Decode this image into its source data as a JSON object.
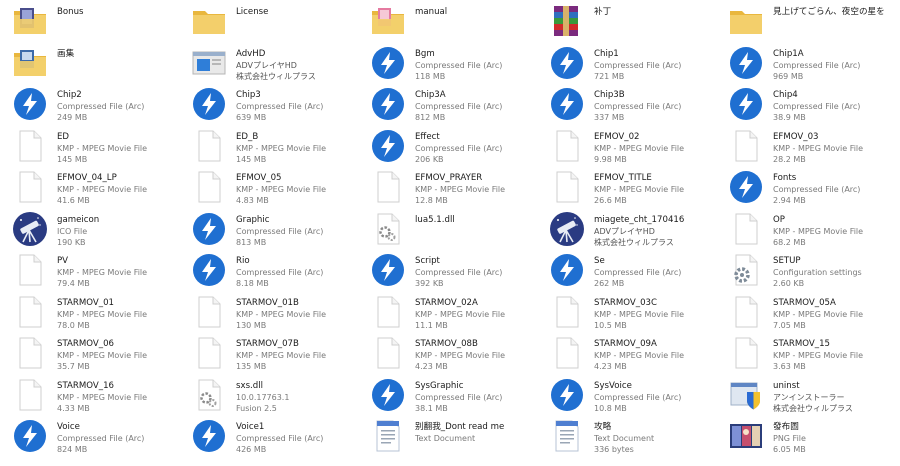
{
  "colors": {
    "folder_body": "#f3cf6b",
    "folder_tab": "#e9b73e",
    "arc_blue": "#1f6fd1",
    "doc_border": "#cfcfcf",
    "text_primary": "#1a1a1a",
    "text_secondary": "#7a7a7a"
  },
  "items": [
    {
      "name": "Bonus",
      "line2": "",
      "line3": "",
      "icon": "folder-icon-bonus"
    },
    {
      "name": "License",
      "line2": "",
      "line3": "",
      "icon": "folder-icon"
    },
    {
      "name": "manual",
      "line2": "",
      "line3": "",
      "icon": "folder-icon-manual"
    },
    {
      "name": "补丁",
      "line2": "",
      "line3": "",
      "icon": "winrar-icon"
    },
    {
      "name": "見上げてごらん、夜空の星を",
      "line2": "",
      "line3": "",
      "icon": "folder-icon"
    },
    {
      "name": "画集",
      "line2": "",
      "line3": "",
      "icon": "folder-icon-images"
    },
    {
      "name": "AdvHD",
      "line2": "ADVプレイヤHD",
      "line3": "株式会社ウィルプラス",
      "icon": "advhd-app-icon"
    },
    {
      "name": "Bgm",
      "line2": "Compressed File (Arc)",
      "line3": "118 MB",
      "icon": "arc-file-icon"
    },
    {
      "name": "Chip1",
      "line2": "Compressed File (Arc)",
      "line3": "721 MB",
      "icon": "arc-file-icon"
    },
    {
      "name": "Chip1A",
      "line2": "Compressed File (Arc)",
      "line3": "969 MB",
      "icon": "arc-file-icon"
    },
    {
      "name": "Chip2",
      "line2": "Compressed File (Arc)",
      "line3": "249 MB",
      "icon": "arc-file-icon"
    },
    {
      "name": "Chip3",
      "line2": "Compressed File (Arc)",
      "line3": "639 MB",
      "icon": "arc-file-icon"
    },
    {
      "name": "Chip3A",
      "line2": "Compressed File (Arc)",
      "line3": "812 MB",
      "icon": "arc-file-icon"
    },
    {
      "name": "Chip3B",
      "line2": "Compressed File (Arc)",
      "line3": "337 MB",
      "icon": "arc-file-icon"
    },
    {
      "name": "Chip4",
      "line2": "Compressed File (Arc)",
      "line3": "38.9 MB",
      "icon": "arc-file-icon"
    },
    {
      "name": "ED",
      "line2": "KMP - MPEG Movie File",
      "line3": "145 MB",
      "icon": "blank-file-icon"
    },
    {
      "name": "ED_B",
      "line2": "KMP - MPEG Movie File",
      "line3": "145 MB",
      "icon": "blank-file-icon"
    },
    {
      "name": "Effect",
      "line2": "Compressed File (Arc)",
      "line3": "206 KB",
      "icon": "arc-file-icon"
    },
    {
      "name": "EFMOV_02",
      "line2": "KMP - MPEG Movie File",
      "line3": "9.98 MB",
      "icon": "blank-file-icon"
    },
    {
      "name": "EFMOV_03",
      "line2": "KMP - MPEG Movie File",
      "line3": "28.2 MB",
      "icon": "blank-file-icon"
    },
    {
      "name": "EFMOV_04_LP",
      "line2": "KMP - MPEG Movie File",
      "line3": "41.6 MB",
      "icon": "blank-file-icon"
    },
    {
      "name": "EFMOV_05",
      "line2": "KMP - MPEG Movie File",
      "line3": "4.83 MB",
      "icon": "blank-file-icon"
    },
    {
      "name": "EFMOV_PRAYER",
      "line2": "KMP - MPEG Movie File",
      "line3": "12.8 MB",
      "icon": "blank-file-icon"
    },
    {
      "name": "EFMOV_TITLE",
      "line2": "KMP - MPEG Movie File",
      "line3": "26.6 MB",
      "icon": "blank-file-icon"
    },
    {
      "name": "Fonts",
      "line2": "Compressed File (Arc)",
      "line3": "2.94 MB",
      "icon": "arc-file-icon"
    },
    {
      "name": "gameicon",
      "line2": "ICO File",
      "line3": "190 KB",
      "icon": "telescope-icon"
    },
    {
      "name": "Graphic",
      "line2": "Compressed File (Arc)",
      "line3": "813 MB",
      "icon": "arc-file-icon"
    },
    {
      "name": "lua5.1.dll",
      "line2": "",
      "line3": "",
      "icon": "dll-file-icon"
    },
    {
      "name": "miagete_cht_170416",
      "line2": "ADVプレイヤHD",
      "line3": "株式会社ウィルプラス",
      "icon": "telescope-icon"
    },
    {
      "name": "OP",
      "line2": "KMP - MPEG Movie File",
      "line3": "68.2 MB",
      "icon": "blank-file-icon"
    },
    {
      "name": "PV",
      "line2": "KMP - MPEG Movie File",
      "line3": "79.4 MB",
      "icon": "blank-file-icon"
    },
    {
      "name": "Rio",
      "line2": "Compressed File (Arc)",
      "line3": "8.18 MB",
      "icon": "arc-file-icon"
    },
    {
      "name": "Script",
      "line2": "Compressed File (Arc)",
      "line3": "392 KB",
      "icon": "arc-file-icon"
    },
    {
      "name": "Se",
      "line2": "Compressed File (Arc)",
      "line3": "262 MB",
      "icon": "arc-file-icon"
    },
    {
      "name": "SETUP",
      "line2": "Configuration settings",
      "line3": "2.60 KB",
      "icon": "settings-file-icon"
    },
    {
      "name": "STARMOV_01",
      "line2": "KMP - MPEG Movie File",
      "line3": "78.0 MB",
      "icon": "blank-file-icon"
    },
    {
      "name": "STARMOV_01B",
      "line2": "KMP - MPEG Movie File",
      "line3": "130 MB",
      "icon": "blank-file-icon"
    },
    {
      "name": "STARMOV_02A",
      "line2": "KMP - MPEG Movie File",
      "line3": "11.1 MB",
      "icon": "blank-file-icon"
    },
    {
      "name": "STARMOV_03C",
      "line2": "KMP - MPEG Movie File",
      "line3": "10.5 MB",
      "icon": "blank-file-icon"
    },
    {
      "name": "STARMOV_05A",
      "line2": "KMP - MPEG Movie File",
      "line3": "7.05 MB",
      "icon": "blank-file-icon"
    },
    {
      "name": "STARMOV_06",
      "line2": "KMP - MPEG Movie File",
      "line3": "35.7 MB",
      "icon": "blank-file-icon"
    },
    {
      "name": "STARMOV_07B",
      "line2": "KMP - MPEG Movie File",
      "line3": "135 MB",
      "icon": "blank-file-icon"
    },
    {
      "name": "STARMOV_08B",
      "line2": "KMP - MPEG Movie File",
      "line3": "4.23 MB",
      "icon": "blank-file-icon"
    },
    {
      "name": "STARMOV_09A",
      "line2": "KMP - MPEG Movie File",
      "line3": "4.23 MB",
      "icon": "blank-file-icon"
    },
    {
      "name": "STARMOV_15",
      "line2": "KMP - MPEG Movie File",
      "line3": "3.63 MB",
      "icon": "blank-file-icon"
    },
    {
      "name": "STARMOV_16",
      "line2": "KMP - MPEG Movie File",
      "line3": "4.33 MB",
      "icon": "blank-file-icon"
    },
    {
      "name": "sxs.dll",
      "line2": "10.0.17763.1",
      "line3": "Fusion 2.5",
      "icon": "dll-file-icon"
    },
    {
      "name": "SysGraphic",
      "line2": "Compressed File (Arc)",
      "line3": "38.1 MB",
      "icon": "arc-file-icon"
    },
    {
      "name": "SysVoice",
      "line2": "Compressed File (Arc)",
      "line3": "10.8 MB",
      "icon": "arc-file-icon"
    },
    {
      "name": "uninst",
      "line2": "アンインストーラー",
      "line3": "株式会社ウィルプラス",
      "icon": "uninstaller-icon"
    },
    {
      "name": "Voice",
      "line2": "Compressed File (Arc)",
      "line3": "824 MB",
      "icon": "arc-file-icon"
    },
    {
      "name": "Voice1",
      "line2": "Compressed File (Arc)",
      "line3": "426 MB",
      "icon": "arc-file-icon"
    },
    {
      "name": "别翻我_Dont read me",
      "line2": "Text Document",
      "line3": "",
      "icon": "text-document-icon"
    },
    {
      "name": "攻略",
      "line2": "Text Document",
      "line3": "336 bytes",
      "icon": "text-document-icon"
    },
    {
      "name": "發布圖",
      "line2": "PNG File",
      "line3": "6.05 MB",
      "icon": "png-image-icon"
    }
  ]
}
